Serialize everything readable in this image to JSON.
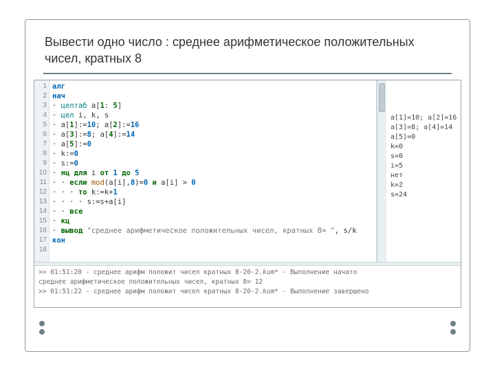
{
  "title": "Вывести одно число : среднее арифметическое положительных чисел, кратных 8",
  "lineCount": 18,
  "code": [
    {
      "raw": "алг",
      "cls": [
        "kw"
      ]
    },
    {
      "raw": "нач",
      "cls": [
        "kw"
      ]
    },
    {
      "raw": "· целтаб a[1: 5]",
      "seg": [
        {
          "t": "· "
        },
        {
          "t": "целтаб",
          "c": "type"
        },
        {
          "t": " a["
        },
        {
          "t": "1",
          "c": "idx"
        },
        {
          "t": ": "
        },
        {
          "t": "5",
          "c": "idx"
        },
        {
          "t": "]"
        }
      ]
    },
    {
      "raw": "· цел i, k, s",
      "seg": [
        {
          "t": "· "
        },
        {
          "t": "цел",
          "c": "type"
        },
        {
          "t": " i, k, s"
        }
      ]
    },
    {
      "raw": "· a[1]:=10; a[2]:=16",
      "seg": [
        {
          "t": "· a["
        },
        {
          "t": "1",
          "c": "idx"
        },
        {
          "t": "]:="
        },
        {
          "t": "10",
          "c": "num"
        },
        {
          "t": "; a["
        },
        {
          "t": "2",
          "c": "idx"
        },
        {
          "t": "]:="
        },
        {
          "t": "16",
          "c": "num"
        }
      ]
    },
    {
      "raw": "· a[3]:=8; a[4]:=14",
      "seg": [
        {
          "t": "· a["
        },
        {
          "t": "3",
          "c": "idx"
        },
        {
          "t": "]:="
        },
        {
          "t": "8",
          "c": "num"
        },
        {
          "t": "; a["
        },
        {
          "t": "4",
          "c": "idx"
        },
        {
          "t": "]:="
        },
        {
          "t": "14",
          "c": "num"
        }
      ]
    },
    {
      "raw": "· a[5]:=0",
      "seg": [
        {
          "t": "· a["
        },
        {
          "t": "5",
          "c": "idx"
        },
        {
          "t": "]:="
        },
        {
          "t": "0",
          "c": "num"
        }
      ]
    },
    {
      "raw": "· k:=0",
      "seg": [
        {
          "t": "· k:="
        },
        {
          "t": "0",
          "c": "num"
        }
      ]
    },
    {
      "raw": "· s:=0",
      "seg": [
        {
          "t": "· s:="
        },
        {
          "t": "0",
          "c": "num"
        }
      ]
    },
    {
      "raw": "· нц для i от 1 до 5",
      "seg": [
        {
          "t": "· "
        },
        {
          "t": "нц для",
          "c": "kw2"
        },
        {
          "t": " i "
        },
        {
          "t": "от",
          "c": "kw2"
        },
        {
          "t": " "
        },
        {
          "t": "1",
          "c": "num"
        },
        {
          "t": " "
        },
        {
          "t": "до",
          "c": "kw2"
        },
        {
          "t": " "
        },
        {
          "t": "5",
          "c": "num"
        }
      ]
    },
    {
      "raw": "· · если mod(a[i],8)=0 и a[i] > 0",
      "seg": [
        {
          "t": "· · "
        },
        {
          "t": "если",
          "c": "kw2"
        },
        {
          "t": " "
        },
        {
          "t": "mod",
          "c": "mod"
        },
        {
          "t": "(a[i],"
        },
        {
          "t": "8",
          "c": "num"
        },
        {
          "t": ")="
        },
        {
          "t": "0",
          "c": "num"
        },
        {
          "t": " "
        },
        {
          "t": "и",
          "c": "kw2"
        },
        {
          "t": " a[i] > "
        },
        {
          "t": "0",
          "c": "num"
        }
      ]
    },
    {
      "raw": "· · · то k:=k+1",
      "seg": [
        {
          "t": "· · · "
        },
        {
          "t": "то",
          "c": "kw2"
        },
        {
          "t": " k:=k+"
        },
        {
          "t": "1",
          "c": "num"
        }
      ]
    },
    {
      "raw": "· · · · s:=s+a[i]",
      "seg": [
        {
          "t": "· · · · s:=s+a[i]"
        }
      ]
    },
    {
      "raw": "· · все",
      "seg": [
        {
          "t": "· · "
        },
        {
          "t": "все",
          "c": "kw2"
        }
      ]
    },
    {
      "raw": "· кц",
      "seg": [
        {
          "t": "· "
        },
        {
          "t": "кц",
          "c": "kw2"
        }
      ]
    },
    {
      "raw": "· вывод \"среднее арифметическое положительных чисел, кратных 8= \", s/k",
      "seg": [
        {
          "t": "· "
        },
        {
          "t": "вывод",
          "c": "kw2"
        },
        {
          "t": " "
        },
        {
          "t": "\"среднее арифметическое положительных чисел, кратных 8= \"",
          "c": "str"
        },
        {
          "t": ", s/k"
        }
      ]
    },
    {
      "raw": "кон",
      "cls": [
        "kw"
      ]
    }
  ],
  "vars": [
    "a[1]=10; a[2]=16",
    "a[3]=8; a[4]=14",
    "a[5]=0",
    "k=0",
    "s=0",
    "i=5",
    "нет",
    "k=2",
    "s=24"
  ],
  "console": {
    "l1_pre": ">> 01:51:20 - среднее арифм положит чисел кратных 8-20-2.",
    "l1_fn": "kum*",
    "l1_post": " - Выполнение начато",
    "l2": "среднее арифметическое положительных чисел, кратных 8= 12",
    "l3_pre": ">> 01:51:22 - среднее арифм положит чисел кратных 8-20-2.",
    "l3_fn": "kum*",
    "l3_post": " - Выполнение завершено"
  }
}
